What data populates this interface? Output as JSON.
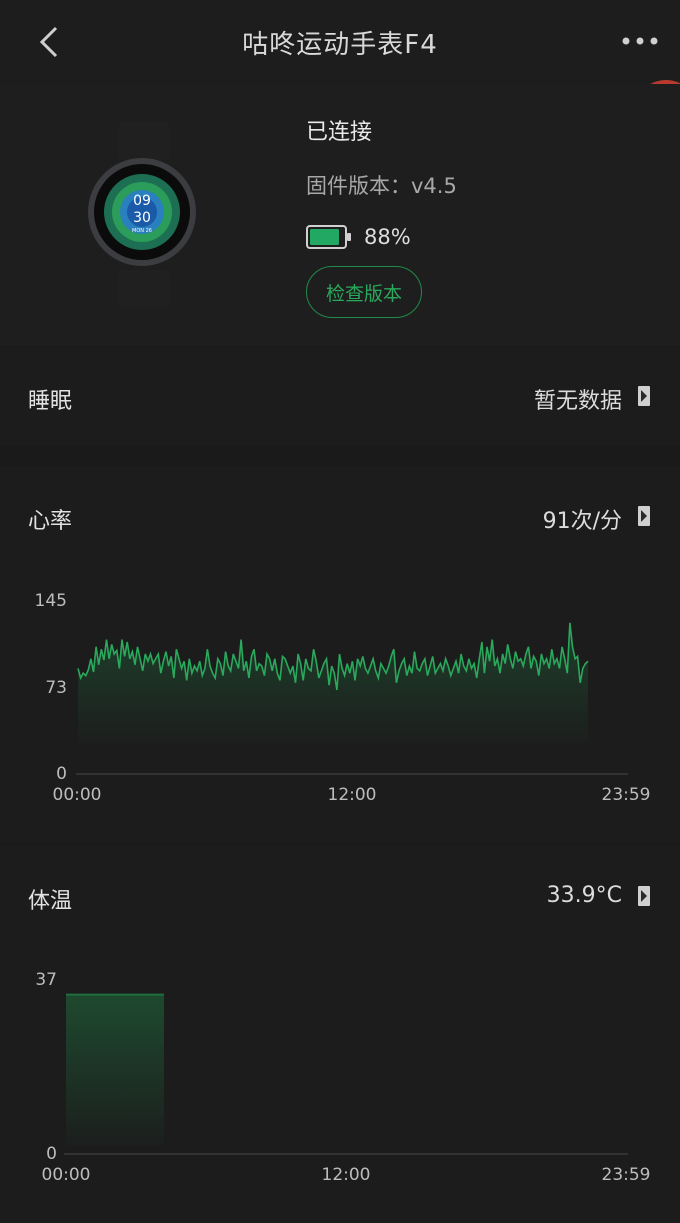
{
  "header": {
    "title": "咕咚运动手表F4",
    "back_icon": "chevron-left-icon",
    "more_icon": "more-dots-icon"
  },
  "device": {
    "status": "已连接",
    "firmware": "固件版本：v4.5",
    "battery": {
      "percent_text": "88%",
      "level": 0.88,
      "color": "#22a863"
    },
    "check_button": "检查版本",
    "watch_face": {
      "hour": "09",
      "minute": "30",
      "date": "MON 26"
    }
  },
  "sleep": {
    "label": "睡眠",
    "value": "暂无数据"
  },
  "heart_rate": {
    "label": "心率",
    "value": "91次/分",
    "chart_data": {
      "type": "line",
      "x_start": "00:00",
      "x_mid": "12:00",
      "x_end": "23:59",
      "yticks": [
        "145",
        "73",
        "0"
      ],
      "ylim": [
        0,
        145
      ],
      "line_color": "#2aa95c",
      "values": [
        88,
        80,
        84,
        82,
        87,
        96,
        85,
        106,
        91,
        104,
        95,
        112,
        96,
        108,
        100,
        103,
        88,
        112,
        98,
        110,
        96,
        102,
        91,
        106,
        96,
        86,
        100,
        94,
        100,
        92,
        96,
        100,
        84,
        94,
        102,
        90,
        98,
        80,
        104,
        96,
        88,
        94,
        78,
        96,
        84,
        90,
        86,
        94,
        82,
        88,
        104,
        90,
        84,
        80,
        96,
        92,
        82,
        102,
        90,
        86,
        100,
        94,
        88,
        112,
        86,
        94,
        80,
        98,
        104,
        86,
        92,
        90,
        82,
        100,
        96,
        86,
        96,
        84,
        78,
        98,
        96,
        90,
        84,
        90,
        76,
        100,
        92,
        78,
        96,
        88,
        86,
        104,
        94,
        80,
        86,
        92,
        96,
        74,
        90,
        84,
        70,
        100,
        88,
        82,
        92,
        84,
        94,
        78,
        96,
        90,
        98,
        88,
        84,
        90,
        96,
        86,
        80,
        92,
        88,
        84,
        90,
        98,
        104,
        76,
        86,
        92,
        96,
        82,
        90,
        84,
        102,
        88,
        86,
        92,
        96,
        82,
        90,
        98,
        84,
        88,
        92,
        86,
        96,
        90,
        82,
        88,
        94,
        84,
        100,
        90,
        86,
        96,
        88,
        92,
        80,
        96,
        110,
        84,
        106,
        94,
        112,
        90,
        96,
        84,
        100,
        92,
        108,
        96,
        88,
        102,
        94,
        96,
        90,
        100,
        106,
        88,
        98,
        94,
        82,
        100,
        92,
        96,
        88,
        104,
        92,
        96,
        88,
        106,
        96,
        84,
        126,
        106,
        96,
        98,
        76,
        88,
        92,
        94
      ]
    }
  },
  "temperature": {
    "label": "体温",
    "value": "33.9°C",
    "chart_data": {
      "type": "area",
      "x_start": "00:00",
      "x_mid": "12:00",
      "x_end": "23:59",
      "yticks": [
        "37",
        "0"
      ],
      "ylim": [
        0,
        37
      ],
      "segment": {
        "from_hour": 0,
        "to_hour": 4.2,
        "value": 33.9
      },
      "line_color": "#1f6e3e"
    }
  }
}
